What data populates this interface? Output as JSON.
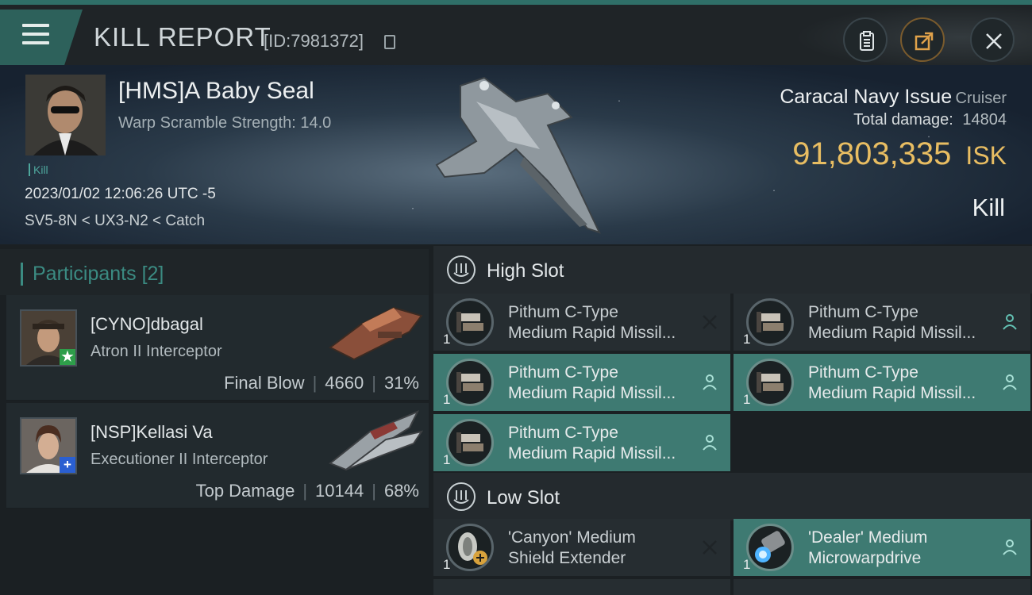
{
  "header": {
    "title": "KILL REPORT",
    "id_text": "[ID:7981372]"
  },
  "victim": {
    "name": "[HMS]A Baby Seal",
    "warp_scramble": "Warp Scramble Strength: 14.0",
    "tag": "Kill",
    "datetime": "2023/01/02 12:06:26 UTC -5",
    "route": "SV5-8N < UX3-N2 < Catch",
    "ship_name": "Caracal Navy Issue",
    "ship_class": "Cruiser",
    "total_damage_label": "Total damage:",
    "total_damage_value": "14804",
    "isk_value": "91,803,335",
    "isk_unit": "ISK",
    "result": "Kill"
  },
  "participants": {
    "title": "Participants",
    "count": "[2]",
    "items": [
      {
        "name": "[CYNO]dbagal",
        "ship": "Atron II Interceptor",
        "role": "Final Blow",
        "damage": "4660",
        "percent": "31%",
        "badge_color": "#2e9e4a"
      },
      {
        "name": "[NSP]Kellasi Va",
        "ship": "Executioner II Interceptor",
        "role": "Top Damage",
        "damage": "10144",
        "percent": "68%",
        "badge_color": "#2a5fd1"
      }
    ]
  },
  "fitting": {
    "high_slot": {
      "title": "High Slot",
      "modules": [
        {
          "line1": "Pithum C-Type",
          "line2": "Medium Rapid Missil...",
          "count": "1",
          "state": "destroyed",
          "action_icon": "close-icon"
        },
        {
          "line1": "Pithum C-Type",
          "line2": "Medium Rapid Missil...",
          "count": "1",
          "state": "normal",
          "action_icon": "person-icon"
        },
        {
          "line1": "Pithum C-Type",
          "line2": "Medium Rapid Missil...",
          "count": "1",
          "state": "dropped",
          "action_icon": "person-icon"
        },
        {
          "line1": "Pithum C-Type",
          "line2": "Medium Rapid Missil...",
          "count": "1",
          "state": "dropped",
          "action_icon": "person-icon"
        },
        {
          "line1": "Pithum C-Type",
          "line2": "Medium Rapid Missil...",
          "count": "1",
          "state": "dropped",
          "action_icon": "person-icon"
        }
      ]
    },
    "low_slot": {
      "title": "Low Slot",
      "modules": [
        {
          "line1": "'Canyon' Medium",
          "line2": "Shield Extender",
          "count": "1",
          "state": "destroyed",
          "action_icon": "close-icon"
        },
        {
          "line1": "'Dealer' Medium",
          "line2": "Microwarpdrive",
          "count": "1",
          "state": "dropped",
          "action_icon": "person-icon"
        }
      ]
    }
  },
  "colors": {
    "accent_teal": "#3e7a72",
    "isk_gold": "#e8bd62"
  }
}
